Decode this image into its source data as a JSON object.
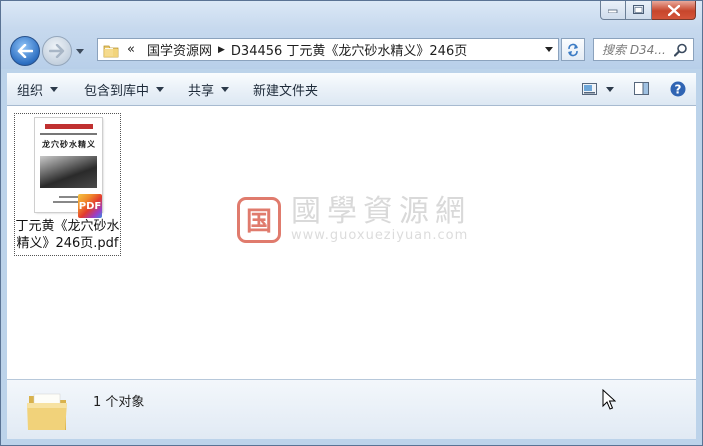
{
  "window": {
    "caption_buttons": [
      "minimize",
      "maximize",
      "close"
    ]
  },
  "nav": {
    "back_icon": "back-arrow-icon",
    "forward_icon": "forward-arrow-icon"
  },
  "address": {
    "overflow": "«",
    "crumbs": [
      "国学资源网",
      "D34456 丁元黄《龙穴砂水精义》246页"
    ]
  },
  "search": {
    "placeholder": "搜索 D34..."
  },
  "toolbar": {
    "organize": "组织",
    "include_in_library": "包含到库中",
    "share": "共享",
    "new_folder": "新建文件夹"
  },
  "files": [
    {
      "name": "丁元黄《龙穴砂水精义》246页.pdf",
      "name_line1": "丁元黄《龙穴砂水",
      "name_line2": "精义》246页.pdf",
      "thumb_title": "龙穴砂水精义",
      "badge": "PDF"
    }
  ],
  "watermark": {
    "seal": "国",
    "title": "國學資源網",
    "url": "www.guoxueziyuan.com"
  },
  "status": {
    "count_text": "1 个对象"
  },
  "colors": {
    "frame": "#bcd3ea",
    "close_button": "#c7462c",
    "pdf_badge_red": "#e23b2e",
    "watermark_red": "#e07b6d"
  }
}
